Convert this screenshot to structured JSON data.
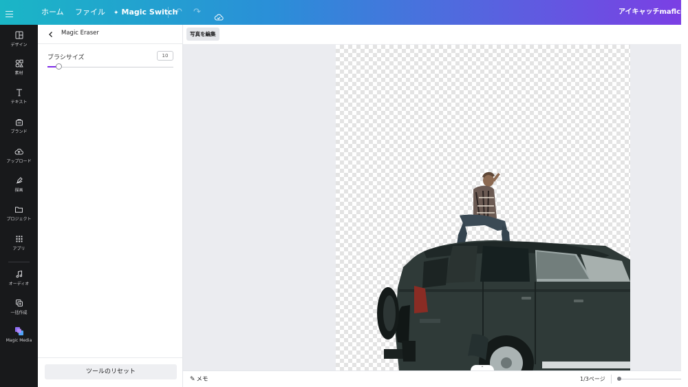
{
  "topbar": {
    "home": "ホーム",
    "file": "ファイル",
    "magic_switch": "Magic Switch",
    "title": "アイキャッチmaflcmed"
  },
  "rail": [
    {
      "label": "デザイン",
      "icon": "design-icon"
    },
    {
      "label": "素材",
      "icon": "elements-icon"
    },
    {
      "label": "テキスト",
      "icon": "text-icon"
    },
    {
      "label": "ブランド",
      "icon": "brand-icon"
    },
    {
      "label": "アップロード",
      "icon": "upload-icon"
    },
    {
      "label": "描画",
      "icon": "draw-icon"
    },
    {
      "label": "プロジェクト",
      "icon": "folder-icon"
    },
    {
      "label": "アプリ",
      "icon": "apps-icon"
    },
    {
      "label": "オーディオ",
      "icon": "audio-icon"
    },
    {
      "label": "一括作成",
      "icon": "bulk-create-icon"
    },
    {
      "label": "Magic Media",
      "icon": "magic-media-icon"
    }
  ],
  "panel": {
    "title": "Magic Eraser",
    "brush_label": "ブラシサイズ",
    "brush_value": "10",
    "reset": "ツールのリセット"
  },
  "editor": {
    "edit_photo": "写真を編集",
    "notes": "メモ",
    "page_counter": "1/3ページ"
  },
  "colors": {
    "accent": "#7d2ae8",
    "rail_bg": "#18191b",
    "canvas_bg": "#ebecf0"
  }
}
